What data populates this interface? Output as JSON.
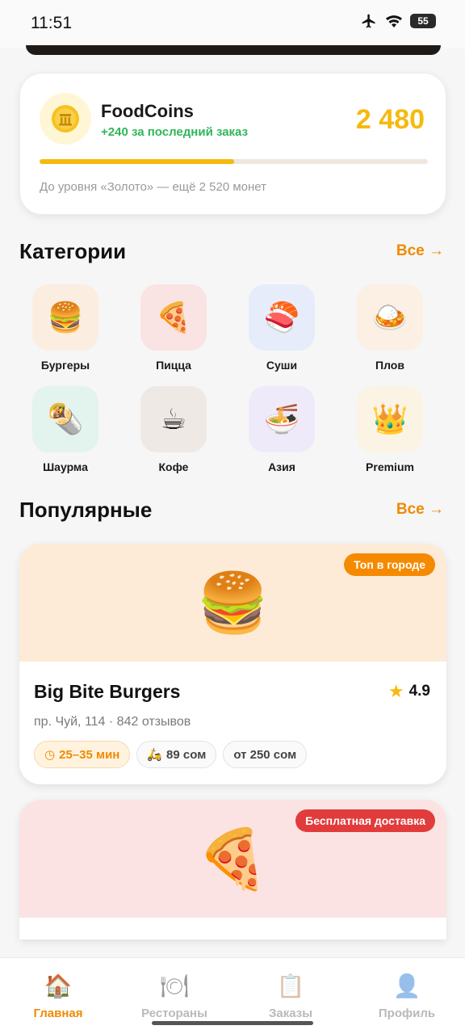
{
  "status": {
    "time": "11:51",
    "battery": "55"
  },
  "coins": {
    "title": "FoodCoins",
    "subtitle": "+240 за последний заказ",
    "value": "2 480",
    "progress": 0.5,
    "note": "До уровня «Золото» — ещё 2 520 монет",
    "icon": "coin-icon"
  },
  "categories": {
    "title": "Категории",
    "all_label": "Все →",
    "items": [
      {
        "label": "Бургеры",
        "emoji": "🍔",
        "bg": "#fbeee0"
      },
      {
        "label": "Пицца",
        "emoji": "🍕",
        "bg": "#f9e3e3"
      },
      {
        "label": "Суши",
        "emoji": "🍣",
        "bg": "#e6ecfa"
      },
      {
        "label": "Плов",
        "emoji": "🍛",
        "bg": "#fbf0e3"
      },
      {
        "label": "Шаурма",
        "emoji": "🌯",
        "bg": "#e3f3ee"
      },
      {
        "label": "Кофе",
        "emoji": "☕",
        "bg": "#efe9e6"
      },
      {
        "label": "Азия",
        "emoji": "🍜",
        "bg": "#efeafa"
      },
      {
        "label": "Premium",
        "emoji": "👑",
        "bg": "#fbf3e3"
      }
    ]
  },
  "popular": {
    "title": "Популярные",
    "all_label": "Все →",
    "restaurants": [
      {
        "badge": "Топ в городе",
        "badge_color": "#f58a00",
        "media_bg": "#fdebd7",
        "emoji": "🍔",
        "name": "Big Bite Burgers",
        "rating": "4.9",
        "address": "пр. Чуй, 114 · 842 отзывов",
        "time": "25–35 мин",
        "delivery": "89 сом",
        "min_order": "от 250 сом"
      },
      {
        "badge": "Бесплатная доставка",
        "badge_color": "#e23b3b",
        "media_bg": "#fce3e3",
        "emoji": "🍕"
      }
    ]
  },
  "nav": {
    "items": [
      {
        "label": "Главная",
        "emoji": "🏠",
        "active": true
      },
      {
        "label": "Рестораны",
        "emoji": "🍽",
        "active": false
      },
      {
        "label": "Заказы",
        "emoji": "📋",
        "active": false
      },
      {
        "label": "Профиль",
        "emoji": "👤",
        "active": false
      }
    ]
  }
}
